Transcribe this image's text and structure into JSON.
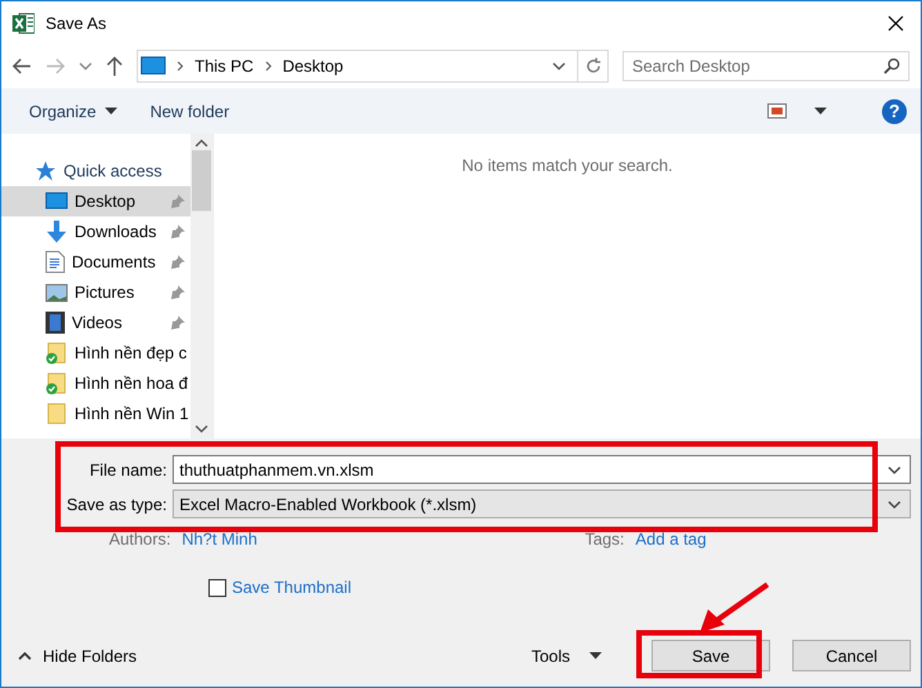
{
  "window": {
    "title": "Save As"
  },
  "address": {
    "path": [
      "This PC",
      "Desktop"
    ]
  },
  "search": {
    "placeholder": "Search Desktop"
  },
  "toolbar": {
    "buttons": [
      "Organize",
      "New folder"
    ],
    "help": "?"
  },
  "nav": {
    "items": [
      {
        "kind": "quick-access",
        "label": "Quick access",
        "selected": false,
        "pinned": false
      },
      {
        "kind": "desktop",
        "label": "Desktop",
        "selected": true,
        "pinned": true
      },
      {
        "kind": "downloads",
        "label": "Downloads",
        "selected": false,
        "pinned": true
      },
      {
        "kind": "documents",
        "label": "Documents",
        "selected": false,
        "pinned": true
      },
      {
        "kind": "pictures",
        "label": "Pictures",
        "selected": false,
        "pinned": true
      },
      {
        "kind": "videos",
        "label": "Videos",
        "selected": false,
        "pinned": true
      },
      {
        "kind": "shared-folder",
        "label": "Hình nền đẹp c",
        "selected": false,
        "pinned": false
      },
      {
        "kind": "shared-folder",
        "label": "Hình nền hoa đ",
        "selected": false,
        "pinned": false
      },
      {
        "kind": "folder",
        "label": "Hình nền Win 1",
        "selected": false,
        "pinned": false
      }
    ]
  },
  "content": {
    "message": "No items match your search."
  },
  "form": {
    "file_name": {
      "label": "File name:",
      "value": "thuthuatphanmem.vn.xlsm"
    },
    "save_as_type": {
      "label": "Save as type:",
      "value": "Excel Macro-Enabled Workbook (*.xlsm)"
    },
    "authors": {
      "label": "Authors:",
      "value": "Nh?t Minh"
    },
    "tags": {
      "label": "Tags:",
      "value": "Add a tag"
    },
    "save_thumbnail": {
      "label": "Save Thumbnail",
      "checked": false
    }
  },
  "footer": {
    "hide_folders": "Hide Folders",
    "tools": "Tools",
    "save": "Save",
    "cancel": "Cancel"
  }
}
